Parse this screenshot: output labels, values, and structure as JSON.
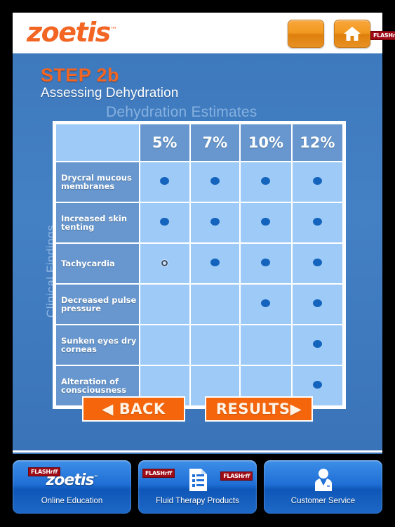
{
  "brand": {
    "logo_text": "zoetis",
    "trademark": "™",
    "home_button_label": "home-button",
    "blank_button_label": "menu-button",
    "flash_badge": "FLASH",
    "flash_badge_italic": "rff"
  },
  "header": {
    "step": "STEP 2b",
    "subtitle": "Assessing Dehydration"
  },
  "table": {
    "caption": "Dehydration Estimates",
    "row_axis_label": "Clinical Findings",
    "corner_cell": "",
    "columns": [
      "5%",
      "7%",
      "10%",
      "12%"
    ],
    "rows": [
      {
        "label": "Drycral mucous membranes",
        "marks": [
          "dot",
          "dot",
          "dot",
          "dot"
        ]
      },
      {
        "label": "Increased skin tenting",
        "marks": [
          "dot",
          "dot",
          "dot",
          "dot"
        ]
      },
      {
        "label": "Tachycardia",
        "marks": [
          "ring",
          "dot",
          "dot",
          "dot"
        ]
      },
      {
        "label": "Decreased pulse pressure",
        "marks": [
          "",
          "",
          "dot",
          "dot"
        ]
      },
      {
        "label": "Sunken eyes dry corneas",
        "marks": [
          "",
          "",
          "",
          "dot"
        ]
      },
      {
        "label": "Alteration of consciousness",
        "marks": [
          "",
          "",
          "",
          "dot"
        ]
      }
    ]
  },
  "nav": {
    "back": "◀ BACK",
    "results": "RESULTS▶"
  },
  "tiles": [
    {
      "label": "Online Education",
      "icon": "zoetis-logo-icon",
      "logo_text": "zoetis",
      "flash": "FLASH"
    },
    {
      "label": "Fluid Therapy Products",
      "icon": "document-list-icon",
      "flash": "FLASH"
    },
    {
      "label": "Customer Service",
      "icon": "customer-service-person-icon"
    }
  ],
  "colors": {
    "brand_orange": "#F26522",
    "panel_blue": "#4480C4",
    "cell_light": "#9DCAF6",
    "cell_dark": "#6797CE",
    "dot_blue": "#1464BE",
    "button_orange": "#F4650C",
    "caption_blue": "#86B1DE"
  }
}
